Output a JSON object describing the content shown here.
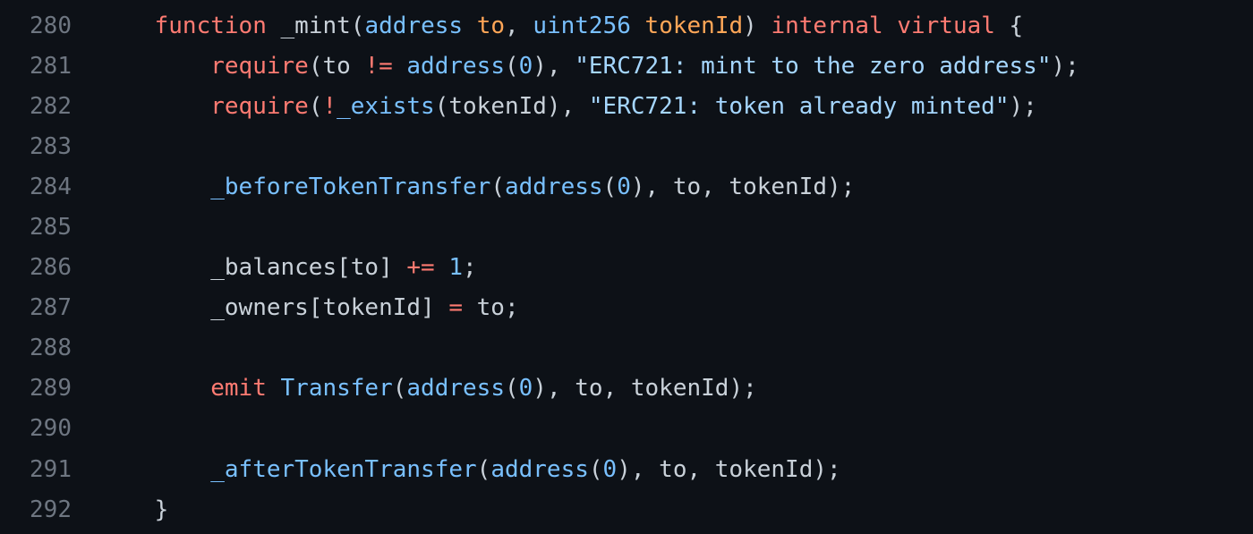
{
  "palette": {
    "background": "#0d1117",
    "line_number": "#6e7681",
    "plain": "#c9d1d9",
    "keyword": "#ff7b72",
    "function": "#d2a8ff",
    "type": "#79c0ff",
    "string": "#a5d6ff",
    "param": "#ffa657"
  },
  "lines": [
    {
      "number": "280",
      "tokens": [
        {
          "text": "    ",
          "cls": "tok-plain"
        },
        {
          "text": "function",
          "cls": "tok-kw"
        },
        {
          "text": " ",
          "cls": "tok-plain"
        },
        {
          "text": "_mint",
          "cls": "tok-plain"
        },
        {
          "text": "(",
          "cls": "tok-plain"
        },
        {
          "text": "address",
          "cls": "tok-type"
        },
        {
          "text": " ",
          "cls": "tok-plain"
        },
        {
          "text": "to",
          "cls": "tok-orange"
        },
        {
          "text": ", ",
          "cls": "tok-plain"
        },
        {
          "text": "uint256",
          "cls": "tok-type"
        },
        {
          "text": " ",
          "cls": "tok-plain"
        },
        {
          "text": "tokenId",
          "cls": "tok-orange"
        },
        {
          "text": ") ",
          "cls": "tok-plain"
        },
        {
          "text": "internal",
          "cls": "tok-kw"
        },
        {
          "text": " ",
          "cls": "tok-plain"
        },
        {
          "text": "virtual",
          "cls": "tok-kw"
        },
        {
          "text": " {",
          "cls": "tok-plain"
        }
      ]
    },
    {
      "number": "281",
      "tokens": [
        {
          "text": "        ",
          "cls": "tok-plain"
        },
        {
          "text": "require",
          "cls": "tok-kw"
        },
        {
          "text": "(",
          "cls": "tok-plain"
        },
        {
          "text": "to",
          "cls": "tok-plain"
        },
        {
          "text": " ",
          "cls": "tok-plain"
        },
        {
          "text": "!=",
          "cls": "tok-kw"
        },
        {
          "text": " ",
          "cls": "tok-plain"
        },
        {
          "text": "address",
          "cls": "tok-type"
        },
        {
          "text": "(",
          "cls": "tok-plain"
        },
        {
          "text": "0",
          "cls": "tok-num"
        },
        {
          "text": "), ",
          "cls": "tok-plain"
        },
        {
          "text": "\"ERC721: mint to the zero address\"",
          "cls": "tok-str"
        },
        {
          "text": ");",
          "cls": "tok-plain"
        }
      ]
    },
    {
      "number": "282",
      "tokens": [
        {
          "text": "        ",
          "cls": "tok-plain"
        },
        {
          "text": "require",
          "cls": "tok-kw"
        },
        {
          "text": "(",
          "cls": "tok-plain"
        },
        {
          "text": "!",
          "cls": "tok-kw"
        },
        {
          "text": "_exists",
          "cls": "tok-type"
        },
        {
          "text": "(tokenId), ",
          "cls": "tok-plain"
        },
        {
          "text": "\"ERC721: token already minted\"",
          "cls": "tok-str"
        },
        {
          "text": ");",
          "cls": "tok-plain"
        }
      ]
    },
    {
      "number": "283",
      "tokens": []
    },
    {
      "number": "284",
      "tokens": [
        {
          "text": "        ",
          "cls": "tok-plain"
        },
        {
          "text": "_beforeTokenTransfer",
          "cls": "tok-type"
        },
        {
          "text": "(",
          "cls": "tok-plain"
        },
        {
          "text": "address",
          "cls": "tok-type"
        },
        {
          "text": "(",
          "cls": "tok-plain"
        },
        {
          "text": "0",
          "cls": "tok-num"
        },
        {
          "text": "), to, tokenId);",
          "cls": "tok-plain"
        }
      ]
    },
    {
      "number": "285",
      "tokens": []
    },
    {
      "number": "286",
      "tokens": [
        {
          "text": "        ",
          "cls": "tok-plain"
        },
        {
          "text": "_balances[to] ",
          "cls": "tok-plain"
        },
        {
          "text": "+=",
          "cls": "tok-kw"
        },
        {
          "text": " ",
          "cls": "tok-plain"
        },
        {
          "text": "1",
          "cls": "tok-num"
        },
        {
          "text": ";",
          "cls": "tok-plain"
        }
      ]
    },
    {
      "number": "287",
      "tokens": [
        {
          "text": "        ",
          "cls": "tok-plain"
        },
        {
          "text": "_owners[tokenId] ",
          "cls": "tok-plain"
        },
        {
          "text": "=",
          "cls": "tok-kw"
        },
        {
          "text": " to;",
          "cls": "tok-plain"
        }
      ]
    },
    {
      "number": "288",
      "tokens": []
    },
    {
      "number": "289",
      "tokens": [
        {
          "text": "        ",
          "cls": "tok-plain"
        },
        {
          "text": "emit",
          "cls": "tok-kw"
        },
        {
          "text": " ",
          "cls": "tok-plain"
        },
        {
          "text": "Transfer",
          "cls": "tok-type"
        },
        {
          "text": "(",
          "cls": "tok-plain"
        },
        {
          "text": "address",
          "cls": "tok-type"
        },
        {
          "text": "(",
          "cls": "tok-plain"
        },
        {
          "text": "0",
          "cls": "tok-num"
        },
        {
          "text": "), to, tokenId);",
          "cls": "tok-plain"
        }
      ]
    },
    {
      "number": "290",
      "tokens": []
    },
    {
      "number": "291",
      "tokens": [
        {
          "text": "        ",
          "cls": "tok-plain"
        },
        {
          "text": "_afterTokenTransfer",
          "cls": "tok-type"
        },
        {
          "text": "(",
          "cls": "tok-plain"
        },
        {
          "text": "address",
          "cls": "tok-type"
        },
        {
          "text": "(",
          "cls": "tok-plain"
        },
        {
          "text": "0",
          "cls": "tok-num"
        },
        {
          "text": "), to, tokenId);",
          "cls": "tok-plain"
        }
      ]
    },
    {
      "number": "292",
      "tokens": [
        {
          "text": "    ",
          "cls": "tok-plain"
        },
        {
          "text": "}",
          "cls": "tok-plain"
        }
      ]
    }
  ]
}
